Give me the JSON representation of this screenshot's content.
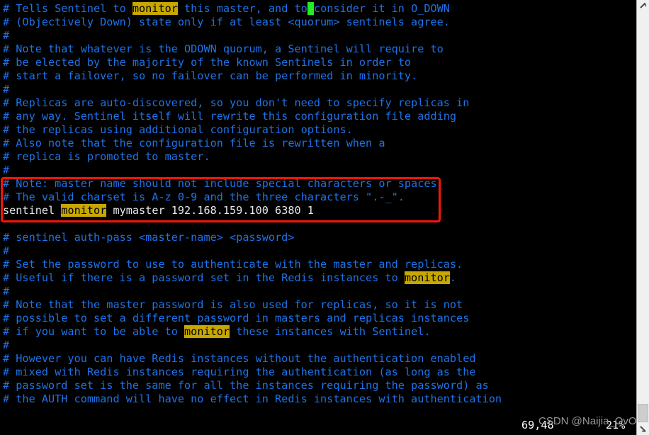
{
  "terminal": {
    "background_color": "#000000",
    "comment_color": "#1e73e8",
    "command_color": "#e8e8e8",
    "highlight_bg_color": "#c8a800",
    "cursor_color": "#22ee22",
    "annotation_box_color": "#fa1408",
    "lines": [
      {
        "id": 0,
        "type": "comment",
        "segments": [
          {
            "t": "# Tells Sentinel to "
          },
          {
            "t": "monitor",
            "s": "hl"
          },
          {
            "t": " this master, and to"
          },
          {
            "t": " ",
            "s": "cursor"
          },
          {
            "t": "consider it in O_DOWN"
          }
        ]
      },
      {
        "id": 1,
        "type": "comment",
        "segments": [
          {
            "t": "# (Objectively Down) state only if at least <quorum> sentinels agree."
          }
        ]
      },
      {
        "id": 2,
        "type": "comment",
        "segments": [
          {
            "t": "#"
          }
        ]
      },
      {
        "id": 3,
        "type": "comment",
        "segments": [
          {
            "t": "# Note that whatever is the ODOWN quorum, a Sentinel will require to"
          }
        ]
      },
      {
        "id": 4,
        "type": "comment",
        "segments": [
          {
            "t": "# be elected by the majority of the known Sentinels in order to"
          }
        ]
      },
      {
        "id": 5,
        "type": "comment",
        "segments": [
          {
            "t": "# start a failover, so no failover can be performed in minority."
          }
        ]
      },
      {
        "id": 6,
        "type": "comment",
        "segments": [
          {
            "t": "#"
          }
        ]
      },
      {
        "id": 7,
        "type": "comment",
        "segments": [
          {
            "t": "# Replicas are auto-discovered, so you don't need to specify replicas in"
          }
        ]
      },
      {
        "id": 8,
        "type": "comment",
        "segments": [
          {
            "t": "# any way. Sentinel itself will rewrite this configuration file adding"
          }
        ]
      },
      {
        "id": 9,
        "type": "comment",
        "segments": [
          {
            "t": "# the replicas using additional configuration options."
          }
        ]
      },
      {
        "id": 10,
        "type": "comment",
        "segments": [
          {
            "t": "# Also note that the configuration file is rewritten when a"
          }
        ]
      },
      {
        "id": 11,
        "type": "comment",
        "segments": [
          {
            "t": "# replica is promoted to master."
          }
        ]
      },
      {
        "id": 12,
        "type": "comment",
        "segments": [
          {
            "t": "#"
          }
        ]
      },
      {
        "id": 13,
        "type": "comment",
        "segments": [
          {
            "t": "# Note: master name should not include special characters or spaces."
          }
        ]
      },
      {
        "id": 14,
        "type": "comment",
        "segments": [
          {
            "t": "# The valid charset is A-z 0-9 and the three characters \".-_\"."
          }
        ]
      },
      {
        "id": 15,
        "type": "command",
        "segments": [
          {
            "t": "sentinel "
          },
          {
            "t": "monitor",
            "s": "hl"
          },
          {
            "t": " mymaster 192.168.159.100 6380 1"
          }
        ]
      },
      {
        "id": 16,
        "type": "comment",
        "segments": [
          {
            "t": ""
          }
        ]
      },
      {
        "id": 17,
        "type": "comment",
        "segments": [
          {
            "t": "# sentinel auth-pass <master-name> <password>"
          }
        ]
      },
      {
        "id": 18,
        "type": "comment",
        "segments": [
          {
            "t": "#"
          }
        ]
      },
      {
        "id": 19,
        "type": "comment",
        "segments": [
          {
            "t": "# Set the password to use to authenticate with the master and replicas."
          }
        ]
      },
      {
        "id": 20,
        "type": "comment",
        "segments": [
          {
            "t": "# Useful if there is a password set in the Redis instances to "
          },
          {
            "t": "monitor",
            "s": "hl"
          },
          {
            "t": "."
          }
        ]
      },
      {
        "id": 21,
        "type": "comment",
        "segments": [
          {
            "t": "#"
          }
        ]
      },
      {
        "id": 22,
        "type": "comment",
        "segments": [
          {
            "t": "# Note that the master password is also used for replicas, so it is not"
          }
        ]
      },
      {
        "id": 23,
        "type": "comment",
        "segments": [
          {
            "t": "# possible to set a different password in masters and replicas instances"
          }
        ]
      },
      {
        "id": 24,
        "type": "comment",
        "segments": [
          {
            "t": "# if you want to be able to "
          },
          {
            "t": "monitor",
            "s": "hl"
          },
          {
            "t": " these instances with Sentinel."
          }
        ]
      },
      {
        "id": 25,
        "type": "comment",
        "segments": [
          {
            "t": "#"
          }
        ]
      },
      {
        "id": 26,
        "type": "comment",
        "segments": [
          {
            "t": "# However you can have Redis instances without the authentication enabled"
          }
        ]
      },
      {
        "id": 27,
        "type": "comment",
        "segments": [
          {
            "t": "# mixed with Redis instances requiring the authentication (as long as the"
          }
        ]
      },
      {
        "id": 28,
        "type": "comment",
        "segments": [
          {
            "t": "# password set is the same for all the instances requiring the password) as"
          }
        ]
      },
      {
        "id": 29,
        "type": "comment",
        "segments": [
          {
            "t": "# the AUTH command will have no effect in Redis instances with authentication"
          }
        ]
      }
    ],
    "annotation": {
      "label": "sentinel-monitor-highlight-box",
      "covers_line_ids": [
        13,
        14,
        15
      ]
    }
  },
  "status": {
    "cursor_position": "69,48",
    "scroll_percent": "21%"
  },
  "watermark": {
    "text": "CSDN @Naijia_OvO"
  },
  "scrollbar": {
    "up_arrow_icon": "chevron-up-icon",
    "down_arrow_icon": "chevron-down-icon",
    "thumb_position_percent": "93"
  }
}
